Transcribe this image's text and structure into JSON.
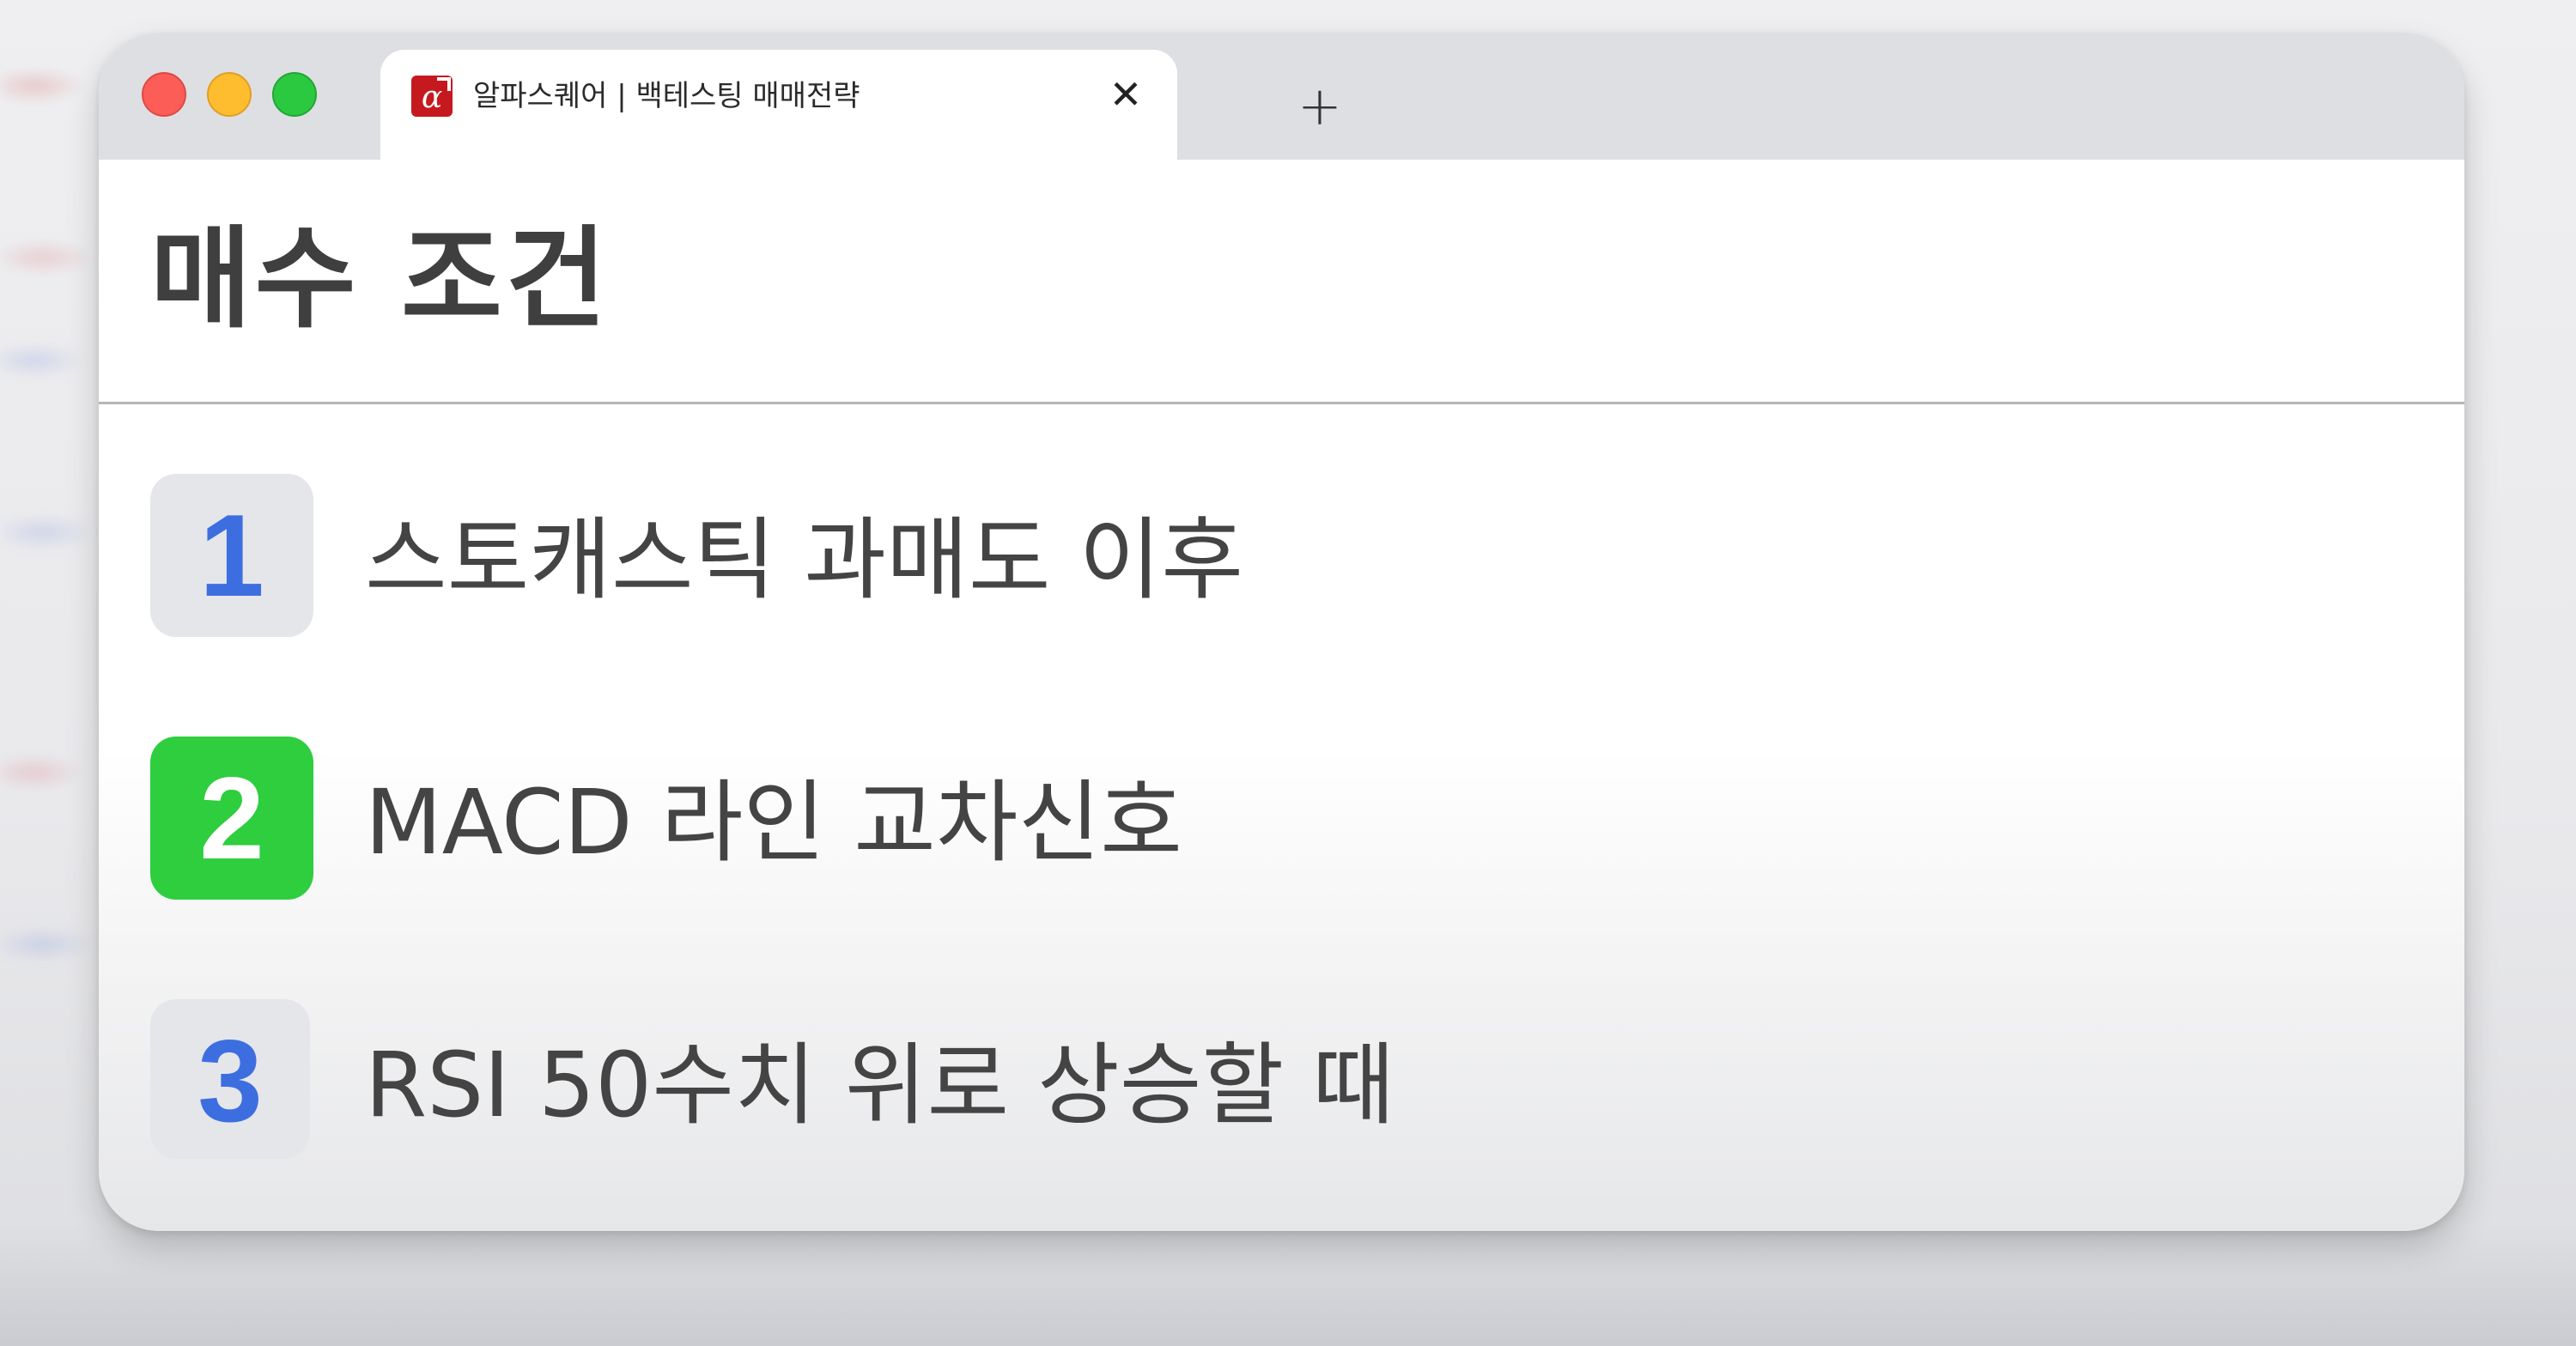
{
  "browser": {
    "tab": {
      "title": "알파스퀘어 | 백테스팅 매매전략",
      "favicon_glyph": "α",
      "favicon_color": "#c6191f",
      "close_glyph": "✕"
    },
    "new_tab_glyph": "+"
  },
  "page": {
    "title": "매수 조건",
    "conditions": [
      {
        "number": "1",
        "text": "스토캐스틱 과매도 이후",
        "badge_color": "#e4e6ea",
        "number_color": "#3d6ee0"
      },
      {
        "number": "2",
        "text": "MACD 라인 교차신호",
        "badge_color": "#2ece3f",
        "number_color": "#ffffff"
      },
      {
        "number": "3",
        "text": "RSI 50수치 위로 상승할 때",
        "badge_color": "#e4e6ea",
        "number_color": "#3d6ee0"
      }
    ]
  }
}
